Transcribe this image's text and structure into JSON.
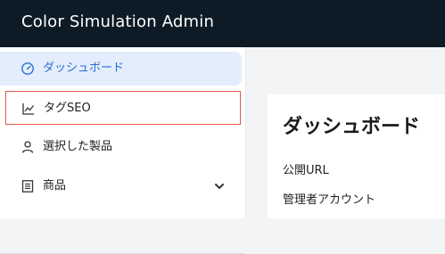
{
  "header": {
    "app_title": "Color Simulation Admin"
  },
  "sidebar": {
    "items": [
      {
        "label": "ダッシュボード",
        "icon": "dashboard-gauge-icon",
        "state": "active"
      },
      {
        "label": "タグSEO",
        "icon": "line-chart-icon",
        "state": "highlighted"
      },
      {
        "label": "選択した製品",
        "icon": "person-icon",
        "state": "normal"
      },
      {
        "label": "商品",
        "icon": "list-box-icon",
        "state": "collapsed",
        "expand_icon": "chevron-down-icon"
      }
    ]
  },
  "main": {
    "title": "ダッシュボード",
    "fields": [
      {
        "label": "公開URL"
      },
      {
        "label": "管理者アカウント"
      }
    ]
  },
  "colors": {
    "topbar": "#0d1b26",
    "accent": "#2c6ed8",
    "active_bg": "#e3edfb",
    "highlight_border": "#e0584a"
  }
}
